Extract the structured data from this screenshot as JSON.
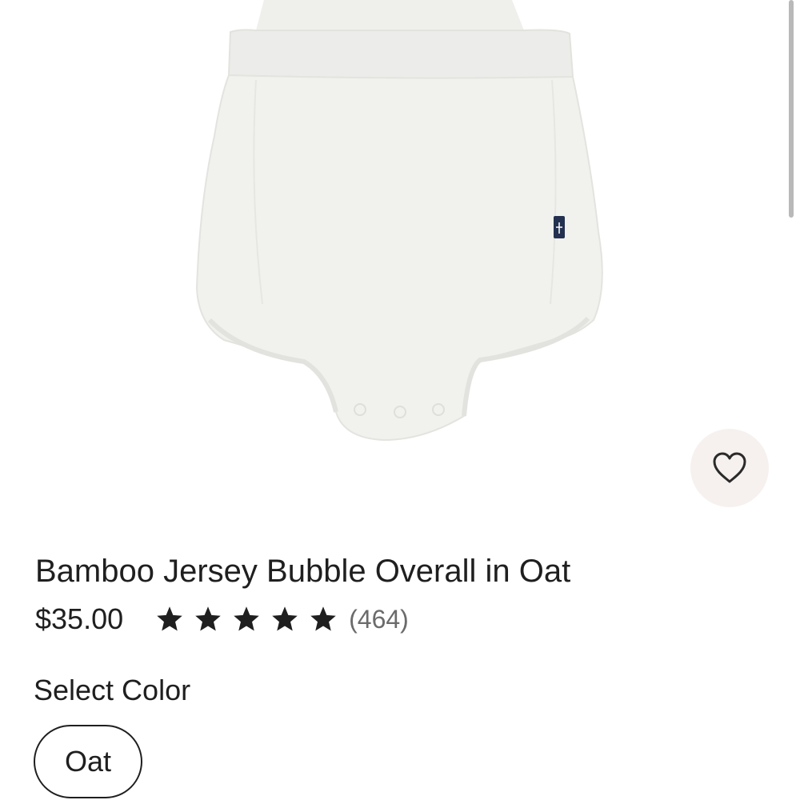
{
  "product": {
    "title": "Bamboo Jersey Bubble Overall in Oat",
    "price": "$35.00",
    "rating": {
      "stars": 5,
      "max_stars": 5,
      "count_label": "(464)"
    },
    "image_icon": "garment-photo"
  },
  "wishlist": {
    "icon": "heart-icon"
  },
  "color_selector": {
    "label": "Select Color",
    "options": [
      {
        "label": "Oat",
        "selected": true
      }
    ]
  },
  "colors": {
    "text": "#1f1f1f",
    "muted_text": "#6b6b6b",
    "garment": "#f1f1ee",
    "wishlist_bg": "#f6f1ef"
  }
}
